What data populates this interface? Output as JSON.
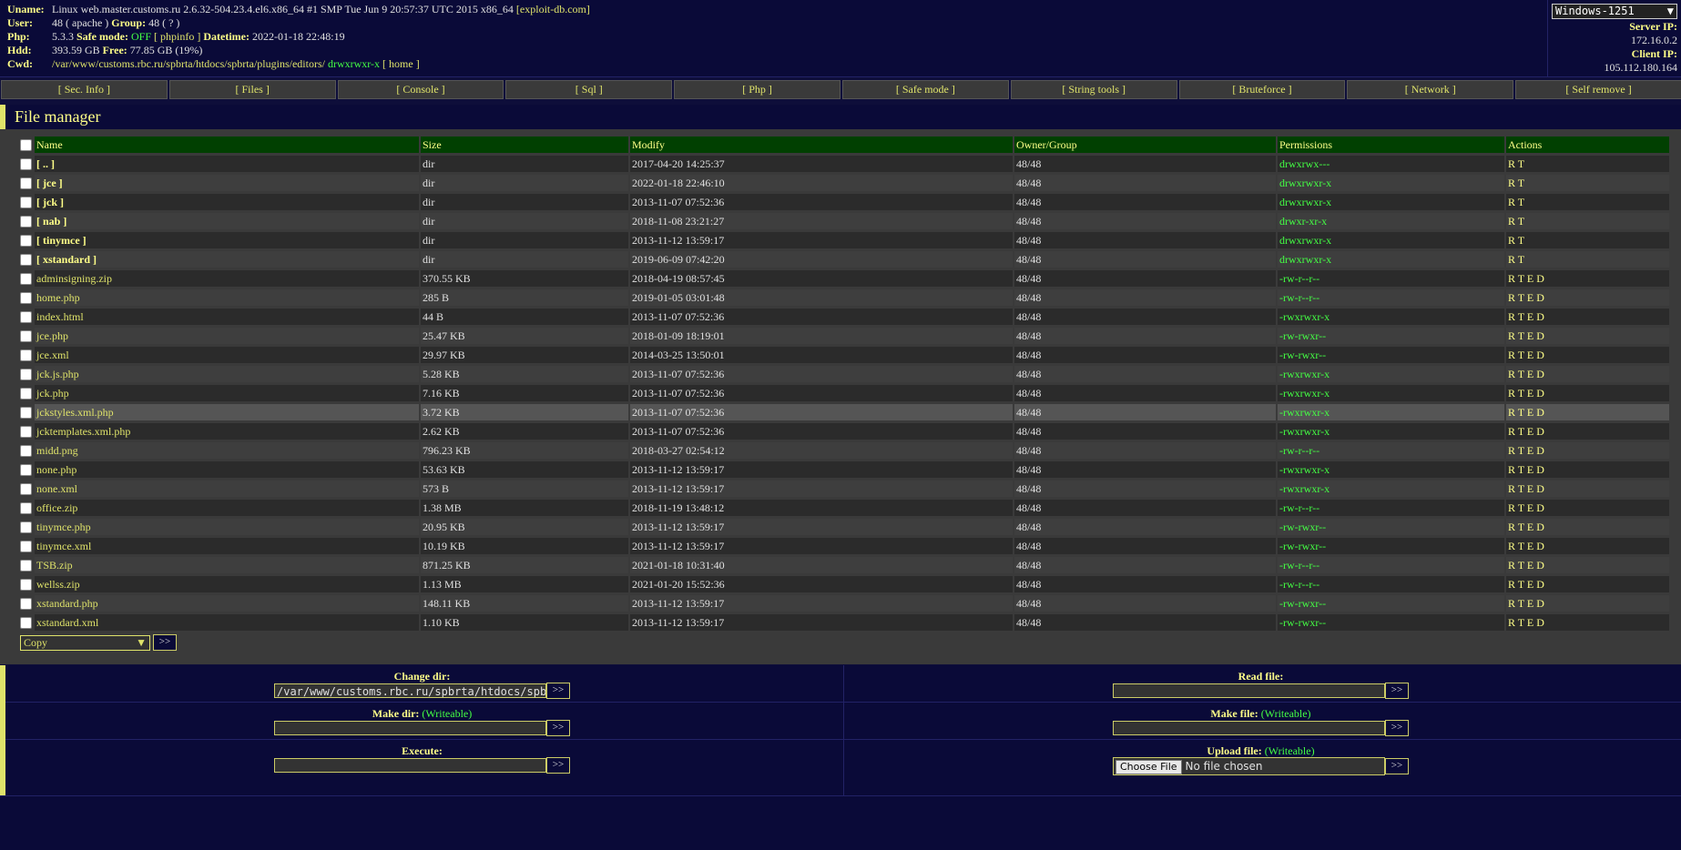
{
  "header": {
    "uname_label": "Uname:",
    "uname_value": "Linux web.master.customs.ru 2.6.32-504.23.4.el6.x86_64 #1 SMP Tue Jun 9 20:57:37 UTC 2015 x86_64",
    "exploit_link": "[exploit-db.com]",
    "user_label": "User:",
    "user_value": "48 ( apache )",
    "group_label": "Group:",
    "group_value": "48 ( ? )",
    "php_label": "Php:",
    "php_version": "5.3.3",
    "safe_mode_label": "Safe mode:",
    "safe_mode_value": "OFF",
    "phpinfo_link": "[ phpinfo ]",
    "datetime_label": "Datetime:",
    "datetime_value": "2022-01-18 22:48:19",
    "hdd_label": "Hdd:",
    "hdd_value": "393.59 GB",
    "free_label": "Free:",
    "free_value": "77.85 GB (19%)",
    "cwd_label": "Cwd:",
    "cwd_value": "/var/www/customs.rbc.ru/spbrta/htdocs/spbrta/plugins/editors/",
    "cwd_perms": "drwxrwxr-x",
    "home_link": "[ home ]",
    "charset_selected": "Windows-1251",
    "server_ip_label": "Server IP:",
    "server_ip": "172.16.0.2",
    "client_ip_label": "Client IP:",
    "client_ip": "105.112.180.164"
  },
  "menu": [
    "[ Sec. Info ]",
    "[ Files ]",
    "[ Console ]",
    "[ Sql ]",
    "[ Php ]",
    "[ Safe mode ]",
    "[ String tools ]",
    "[ Bruteforce ]",
    "[ Network ]",
    "[ Self remove ]"
  ],
  "file_manager": {
    "title": "File manager",
    "columns": [
      "Name",
      "Size",
      "Modify",
      "Owner/Group",
      "Permissions",
      "Actions"
    ],
    "rows": [
      {
        "name": "[ .. ]",
        "size": "dir",
        "modify": "2017-04-20 14:25:37",
        "owner": "48/48",
        "perms": "drwxrwx---",
        "actions": "R T",
        "dir": true
      },
      {
        "name": "[ jce ]",
        "size": "dir",
        "modify": "2022-01-18 22:46:10",
        "owner": "48/48",
        "perms": "drwxrwxr-x",
        "actions": "R T",
        "dir": true
      },
      {
        "name": "[ jck ]",
        "size": "dir",
        "modify": "2013-11-07 07:52:36",
        "owner": "48/48",
        "perms": "drwxrwxr-x",
        "actions": "R T",
        "dir": true
      },
      {
        "name": "[ nab ]",
        "size": "dir",
        "modify": "2018-11-08 23:21:27",
        "owner": "48/48",
        "perms": "drwxr-xr-x",
        "actions": "R T",
        "dir": true
      },
      {
        "name": "[ tinymce ]",
        "size": "dir",
        "modify": "2013-11-12 13:59:17",
        "owner": "48/48",
        "perms": "drwxrwxr-x",
        "actions": "R T",
        "dir": true
      },
      {
        "name": "[ xstandard ]",
        "size": "dir",
        "modify": "2019-06-09 07:42:20",
        "owner": "48/48",
        "perms": "drwxrwxr-x",
        "actions": "R T",
        "dir": true
      },
      {
        "name": "adminsigning.zip",
        "size": "370.55 KB",
        "modify": "2018-04-19 08:57:45",
        "owner": "48/48",
        "perms": "-rw-r--r--",
        "actions": "R T E D",
        "dir": false
      },
      {
        "name": "home.php",
        "size": "285 B",
        "modify": "2019-01-05 03:01:48",
        "owner": "48/48",
        "perms": "-rw-r--r--",
        "actions": "R T E D",
        "dir": false
      },
      {
        "name": "index.html",
        "size": "44 B",
        "modify": "2013-11-07 07:52:36",
        "owner": "48/48",
        "perms": "-rwxrwxr-x",
        "actions": "R T E D",
        "dir": false
      },
      {
        "name": "jce.php",
        "size": "25.47 KB",
        "modify": "2018-01-09 18:19:01",
        "owner": "48/48",
        "perms": "-rw-rwxr--",
        "actions": "R T E D",
        "dir": false
      },
      {
        "name": "jce.xml",
        "size": "29.97 KB",
        "modify": "2014-03-25 13:50:01",
        "owner": "48/48",
        "perms": "-rw-rwxr--",
        "actions": "R T E D",
        "dir": false
      },
      {
        "name": "jck.js.php",
        "size": "5.28 KB",
        "modify": "2013-11-07 07:52:36",
        "owner": "48/48",
        "perms": "-rwxrwxr-x",
        "actions": "R T E D",
        "dir": false
      },
      {
        "name": "jck.php",
        "size": "7.16 KB",
        "modify": "2013-11-07 07:52:36",
        "owner": "48/48",
        "perms": "-rwxrwxr-x",
        "actions": "R T E D",
        "dir": false
      },
      {
        "name": "jckstyles.xml.php",
        "size": "3.72 KB",
        "modify": "2013-11-07 07:52:36",
        "owner": "48/48",
        "perms": "-rwxrwxr-x",
        "actions": "R T E D",
        "dir": false
      },
      {
        "name": "jcktemplates.xml.php",
        "size": "2.62 KB",
        "modify": "2013-11-07 07:52:36",
        "owner": "48/48",
        "perms": "-rwxrwxr-x",
        "actions": "R T E D",
        "dir": false
      },
      {
        "name": "midd.png",
        "size": "796.23 KB",
        "modify": "2018-03-27 02:54:12",
        "owner": "48/48",
        "perms": "-rw-r--r--",
        "actions": "R T E D",
        "dir": false
      },
      {
        "name": "none.php",
        "size": "53.63 KB",
        "modify": "2013-11-12 13:59:17",
        "owner": "48/48",
        "perms": "-rwxrwxr-x",
        "actions": "R T E D",
        "dir": false
      },
      {
        "name": "none.xml",
        "size": "573 B",
        "modify": "2013-11-12 13:59:17",
        "owner": "48/48",
        "perms": "-rwxrwxr-x",
        "actions": "R T E D",
        "dir": false
      },
      {
        "name": "office.zip",
        "size": "1.38 MB",
        "modify": "2018-11-19 13:48:12",
        "owner": "48/48",
        "perms": "-rw-r--r--",
        "actions": "R T E D",
        "dir": false
      },
      {
        "name": "tinymce.php",
        "size": "20.95 KB",
        "modify": "2013-11-12 13:59:17",
        "owner": "48/48",
        "perms": "-rw-rwxr--",
        "actions": "R T E D",
        "dir": false
      },
      {
        "name": "tinymce.xml",
        "size": "10.19 KB",
        "modify": "2013-11-12 13:59:17",
        "owner": "48/48",
        "perms": "-rw-rwxr--",
        "actions": "R T E D",
        "dir": false
      },
      {
        "name": "TSB.zip",
        "size": "871.25 KB",
        "modify": "2021-01-18 10:31:40",
        "owner": "48/48",
        "perms": "-rw-r--r--",
        "actions": "R T E D",
        "dir": false
      },
      {
        "name": "wellss.zip",
        "size": "1.13 MB",
        "modify": "2021-01-20 15:52:36",
        "owner": "48/48",
        "perms": "-rw-r--r--",
        "actions": "R T E D",
        "dir": false
      },
      {
        "name": "xstandard.php",
        "size": "148.11 KB",
        "modify": "2013-11-12 13:59:17",
        "owner": "48/48",
        "perms": "-rw-rwxr--",
        "actions": "R T E D",
        "dir": false
      },
      {
        "name": "xstandard.xml",
        "size": "1.10 KB",
        "modify": "2013-11-12 13:59:17",
        "owner": "48/48",
        "perms": "-rw-rwxr--",
        "actions": "R T E D",
        "dir": false
      }
    ],
    "action_select": "Copy",
    "go_label": ">>"
  },
  "forms": {
    "change_dir_label": "Change dir:",
    "change_dir_value": "/var/www/customs.rbc.ru/spbrta/htdocs/spbrta/plugins/editors/",
    "read_file_label": "Read file:",
    "make_dir_label": "Make dir:",
    "make_file_label": "Make file:",
    "writeable": "(Writeable)",
    "execute_label": "Execute:",
    "upload_label": "Upload file:",
    "choose_file": "Choose File",
    "no_file": "No file chosen",
    "go_label": ">>"
  }
}
